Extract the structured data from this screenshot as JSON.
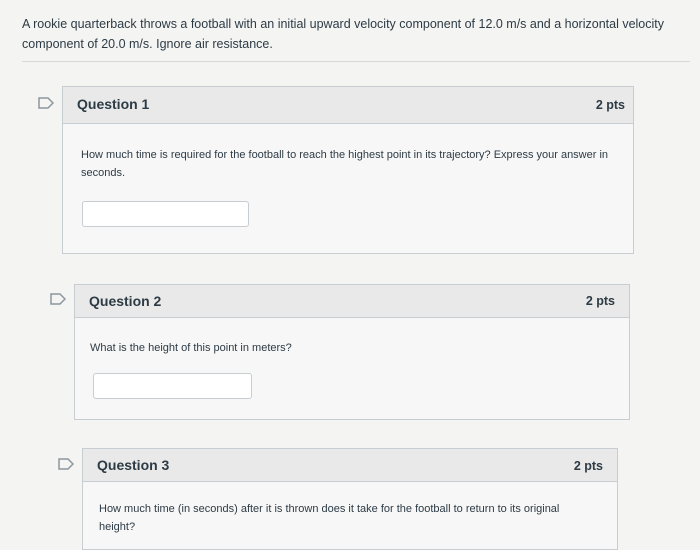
{
  "intro": {
    "text": "A rookie quarterback throws a football with an initial upward velocity component of 12.0 m/s and a horizontal velocity component of 20.0 m/s. Ignore air resistance."
  },
  "questions": [
    {
      "title": "Question 1",
      "points": "2 pts",
      "text": "How much time is required for the football to reach the highest point in its trajectory? Express your answer in seconds.",
      "answer_value": ""
    },
    {
      "title": "Question 2",
      "points": "2 pts",
      "text": "What is the height of this point in meters?",
      "answer_value": ""
    },
    {
      "title": "Question 3",
      "points": "2 pts",
      "text": "How much time (in seconds) after it is thrown does it take for the football to return to its original height?",
      "answer_value": ""
    }
  ],
  "colors": {
    "flag_stroke": "#8b969e",
    "header_bg": "#e9e9e9",
    "card_bg": "#f7f7f7",
    "border": "#c7cdd1"
  },
  "icons": {
    "flag": "flag-question-icon"
  }
}
